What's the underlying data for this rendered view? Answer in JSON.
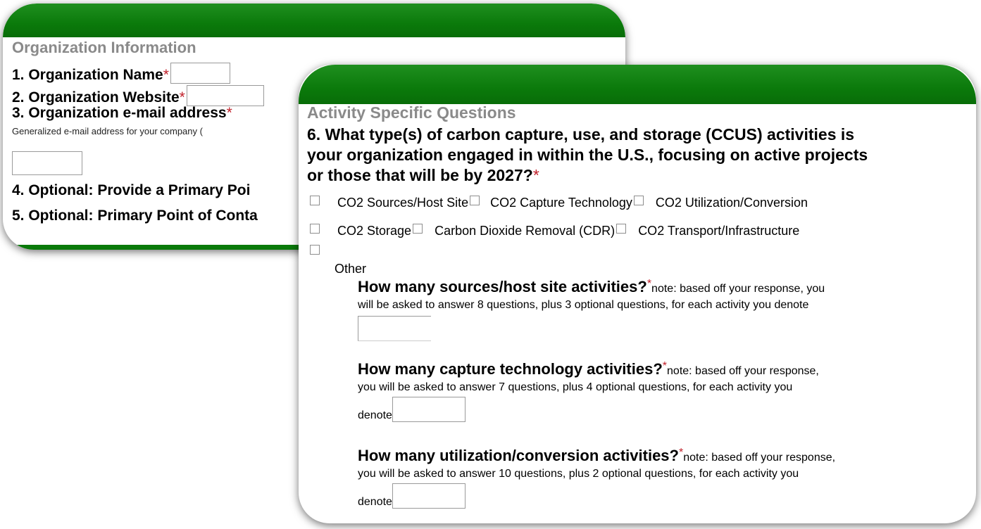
{
  "panel1": {
    "section_title": "Organization Information",
    "q1": "1. Organization Name",
    "q2": "2. Organization Website",
    "q3": "3. Organization e-mail address",
    "q3_hint": "Generalized e-mail address for your company (",
    "q4": "4. Optional: Provide a Primary Poi",
    "q5": "5. Optional: Primary Point of Conta",
    "required_mark": "*"
  },
  "panel2": {
    "section_title": "Activity Specific Questions",
    "q6_line1": "6. What type(s) of carbon capture, use, and storage (CCUS) activities is",
    "q6_line2": "your organization engaged in within the U.S., focusing on active projects",
    "q6_line3": "or those that will be by 2027?",
    "required_mark": "*",
    "options": [
      "CO2 Sources/Host Site",
      "CO2 Capture Technology",
      "CO2 Utilization/Conversion",
      "CO2 Storage",
      "Carbon Dioxide Removal (CDR)",
      "CO2 Transport/Infrastructure",
      "Other"
    ],
    "sub1_title": "How many sources/host site activities?",
    "sub1_note1": "note: based off your response, you",
    "sub1_note2": "will be asked to answer 8 questions, plus 3 optional questions, for each activity you denote",
    "sub2_title": "How many capture technology activities?",
    "sub2_note1": "note: based off your response,",
    "sub2_note2": "you will be asked to answer 7 questions, plus 4 optional questions, for each activity you",
    "sub2_note3": "denote",
    "sub3_title": "How many utilization/conversion activities?",
    "sub3_note1": "note: based off your response,",
    "sub3_note2": "you will be asked to answer 10 questions, plus 2 optional questions, for each activity you",
    "sub3_note3": "denote"
  },
  "colors": {
    "header_green": "#0b7a0b",
    "section_title_gray": "#8a8a8a",
    "required_red": "#c0202a"
  }
}
